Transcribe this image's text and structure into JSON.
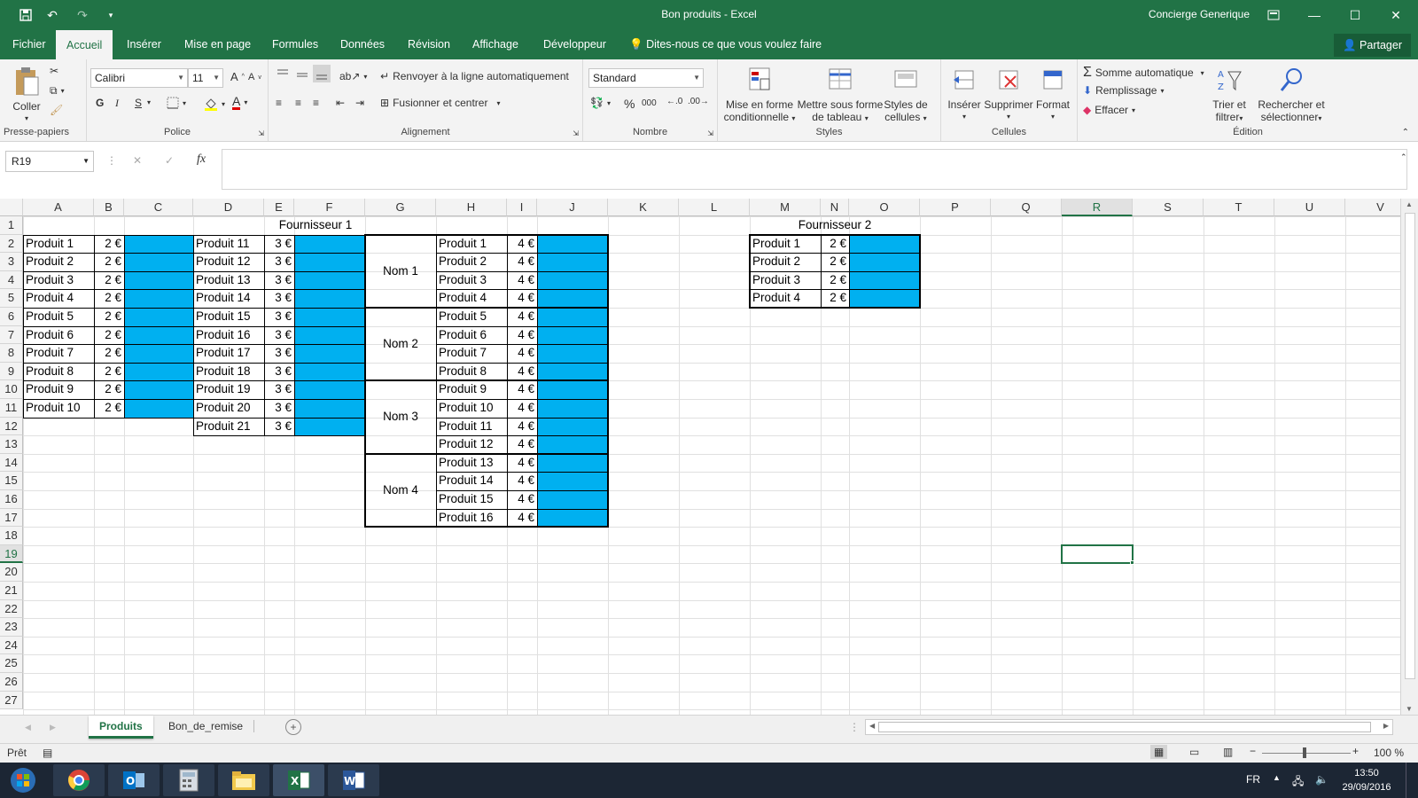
{
  "window": {
    "title": "Bon produits - Excel",
    "user": "Concierge Generique"
  },
  "menu": {
    "tabs": [
      "Fichier",
      "Accueil",
      "Insérer",
      "Mise en page",
      "Formules",
      "Données",
      "Révision",
      "Affichage",
      "Développeur"
    ],
    "tellme": "Dites-nous ce que vous voulez faire",
    "share": "Partager"
  },
  "ribbon": {
    "clipboard": {
      "paste": "Coller",
      "label": "Presse-papiers"
    },
    "font": {
      "name": "Calibri",
      "size": "11",
      "bold": "G",
      "italic": "I",
      "underline": "S",
      "label": "Police"
    },
    "alignment": {
      "wrap": "Renvoyer à la ligne automatiquement",
      "merge": "Fusionner et centrer",
      "label": "Alignement"
    },
    "number": {
      "format": "Standard",
      "percent": "%",
      "thousands": "000",
      "label": "Nombre"
    },
    "styles": {
      "cond1": "Mise en forme",
      "cond2": "conditionnelle",
      "table1": "Mettre sous forme",
      "table2": "de tableau",
      "cell1": "Styles de",
      "cell2": "cellules",
      "label": "Styles"
    },
    "cells": {
      "insert": "Insérer",
      "delete": "Supprimer",
      "format": "Format",
      "label": "Cellules"
    },
    "editing": {
      "autosum": "Somme automatique",
      "fill": "Remplissage",
      "clear": "Effacer",
      "sort1": "Trier et",
      "sort2": "filtrer",
      "find1": "Rechercher et",
      "find2": "sélectionner",
      "label": "Édition"
    }
  },
  "formula_bar": {
    "namebox": "R19",
    "fx": "fx",
    "cancel": "✕",
    "enter": "✓",
    "value": ""
  },
  "grid": {
    "columns": [
      "A",
      "B",
      "C",
      "D",
      "E",
      "F",
      "G",
      "H",
      "I",
      "J",
      "K",
      "L",
      "M",
      "N",
      "O",
      "P",
      "Q",
      "R",
      "S",
      "T",
      "U",
      "V"
    ],
    "rows": [
      "1",
      "2",
      "3",
      "4",
      "5",
      "6",
      "7",
      "8",
      "9",
      "10",
      "11",
      "12",
      "13",
      "14",
      "15",
      "16",
      "17",
      "18",
      "19",
      "20",
      "21",
      "22",
      "23",
      "24",
      "25",
      "26",
      "27"
    ],
    "fournisseur1": "Fournisseur 1",
    "fournisseur2": "Fournisseur 2",
    "block_a": {
      "products": [
        "Produit 1",
        "Produit 2",
        "Produit 3",
        "Produit 4",
        "Produit 5",
        "Produit 6",
        "Produit 7",
        "Produit 8",
        "Produit 9",
        "Produit 10"
      ],
      "price": "2 €"
    },
    "block_d": {
      "products": [
        "Produit 11",
        "Produit 12",
        "Produit 13",
        "Produit 14",
        "Produit 15",
        "Produit 16",
        "Produit 17",
        "Produit 18",
        "Produit 19",
        "Produit 20",
        "Produit 21"
      ],
      "price": "3 €"
    },
    "block_g": {
      "names": [
        "Nom 1",
        "Nom 2",
        "Nom 3",
        "Nom 4"
      ],
      "products": [
        "Produit 1",
        "Produit 2",
        "Produit 3",
        "Produit 4",
        "Produit 5",
        "Produit 6",
        "Produit 7",
        "Produit 8",
        "Produit 9",
        "Produit 10",
        "Produit 11",
        "Produit 12",
        "Produit 13",
        "Produit 14",
        "Produit 15",
        "Produit 16"
      ],
      "price": "4 €"
    },
    "block_m": {
      "products": [
        "Produit 1",
        "Produit 2",
        "Produit 3",
        "Produit 4"
      ],
      "price": "2 €"
    },
    "fill_color": "#00b0f0"
  },
  "sheets": {
    "tabs": [
      "Produits",
      "Bon_de_remise"
    ],
    "active": "Produits"
  },
  "status": {
    "ready": "Prêt",
    "zoom": "100 %"
  },
  "taskbar": {
    "lang": "FR",
    "time": "13:50",
    "date": "29/09/2016"
  },
  "colors": {
    "excel_green": "#217346",
    "taskbar": "#1c2634"
  }
}
